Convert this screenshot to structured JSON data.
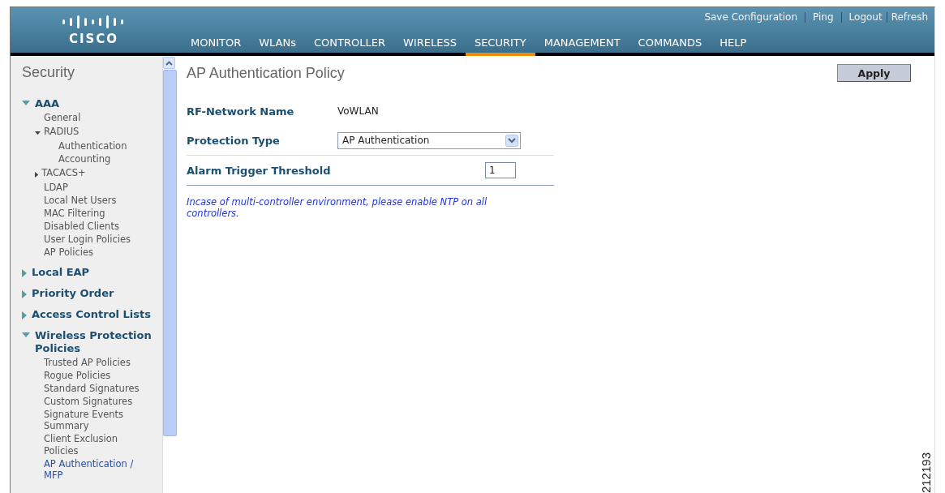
{
  "header": {
    "logo_text": "CISCO",
    "top_links": [
      {
        "label": "Save Configuration"
      },
      {
        "label": "Ping"
      },
      {
        "label": "Logout"
      },
      {
        "label": "Refresh"
      }
    ],
    "nav": [
      {
        "label": "MONITOR",
        "selected": false
      },
      {
        "label": "WLANs",
        "selected": false
      },
      {
        "label": "CONTROLLER",
        "selected": false
      },
      {
        "label": "WIRELESS",
        "selected": false
      },
      {
        "label": "SECURITY",
        "selected": true
      },
      {
        "label": "MANAGEMENT",
        "selected": false
      },
      {
        "label": "COMMANDS",
        "selected": false
      },
      {
        "label": "HELP",
        "selected": false
      }
    ]
  },
  "sidebar": {
    "title": "Security",
    "sections": [
      {
        "label": "AAA",
        "expanded": true,
        "children": [
          {
            "label": "General",
            "selected": false
          },
          {
            "label": "RADIUS",
            "selected": false,
            "expanded": true,
            "children": [
              {
                "label": "Authentication",
                "selected": false
              },
              {
                "label": "Accounting",
                "selected": false
              }
            ]
          },
          {
            "label": "TACACS+",
            "selected": false,
            "expanded": false
          },
          {
            "label": "LDAP",
            "selected": false
          },
          {
            "label": "Local Net Users",
            "selected": false
          },
          {
            "label": "MAC Filtering",
            "selected": false
          },
          {
            "label": "Disabled Clients",
            "selected": false
          },
          {
            "label": "User Login Policies",
            "selected": false
          },
          {
            "label": "AP Policies",
            "selected": false
          }
        ]
      },
      {
        "label": "Local EAP",
        "expanded": false
      },
      {
        "label": "Priority Order",
        "expanded": false
      },
      {
        "label": "Access Control Lists",
        "expanded": false
      },
      {
        "label": "Wireless Protection Policies",
        "expanded": true,
        "children": [
          {
            "label": "Trusted AP Policies",
            "selected": false
          },
          {
            "label": "Rogue Policies",
            "selected": false
          },
          {
            "label": "Standard Signatures",
            "selected": false
          },
          {
            "label": "Custom Signatures",
            "selected": false
          },
          {
            "label": "Signature Events Summary",
            "selected": false
          },
          {
            "label": "Client Exclusion Policies",
            "selected": false
          },
          {
            "label": "AP Authentication / MFP",
            "selected": true
          }
        ]
      }
    ]
  },
  "content": {
    "title": "AP Authentication Policy",
    "apply_button": "Apply",
    "fields": [
      {
        "kind": "text",
        "label": "RF-Network Name",
        "value": "VoWLAN"
      },
      {
        "kind": "select",
        "label": "Protection Type",
        "value": "AP Authentication"
      },
      {
        "kind": "input",
        "label": "Alarm Trigger Threshold",
        "value": "1"
      }
    ],
    "note": "Incase of multi-controller environment, please enable NTP on all controllers."
  },
  "figure_number": "212193"
}
